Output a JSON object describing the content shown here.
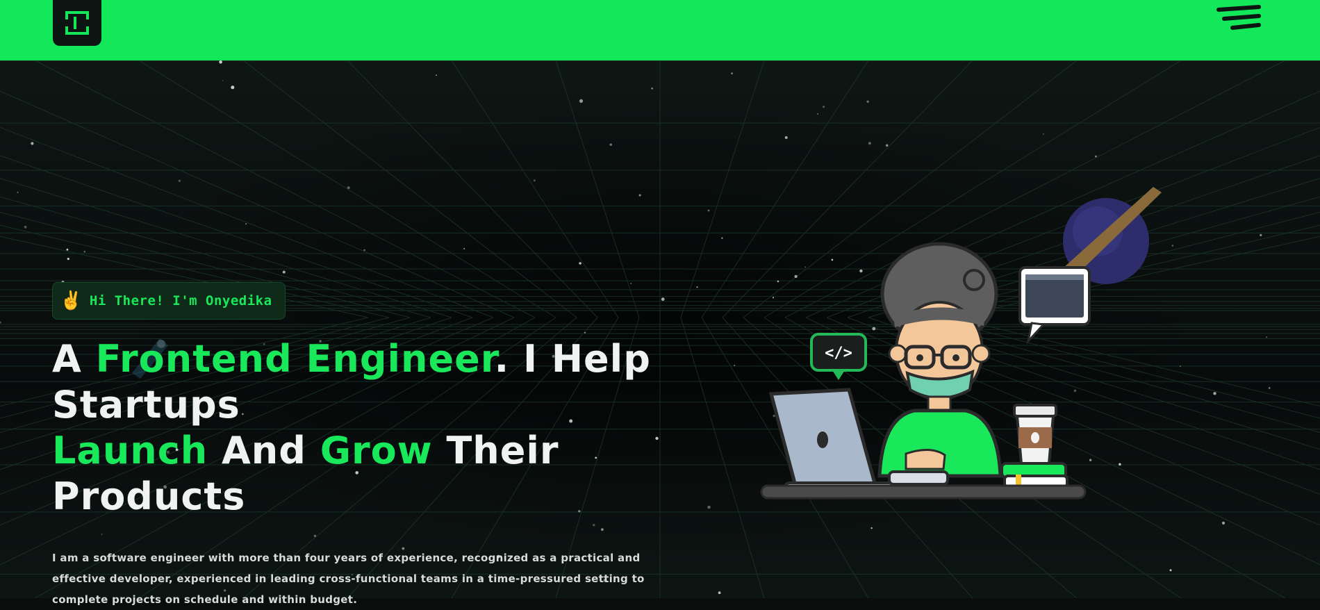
{
  "header": {
    "background_color": "#12e85a",
    "logo_icon": "bracket-logo-icon",
    "menu_icon": "hamburger-menu-icon"
  },
  "hero": {
    "greeting": {
      "emoji": "✌️",
      "text": "Hi There! I'm Onyedika"
    },
    "headline": {
      "part1": "A ",
      "part2": "Frontend Engineer",
      "part3": ". I Help Startups",
      "part4": "Launch",
      "part5": " And ",
      "part6": "Grow",
      "part7": " Their Products"
    },
    "intro": "I am a software engineer with more than four years of experience, recognized as a practical and effective developer, experienced in leading cross-functional teams in a time-pressured setting to complete projects on schedule and within budget.",
    "accent_color": "#19e85b"
  },
  "illustration": {
    "code_bubble_text": "</>",
    "subject": "developer-at-laptop"
  }
}
